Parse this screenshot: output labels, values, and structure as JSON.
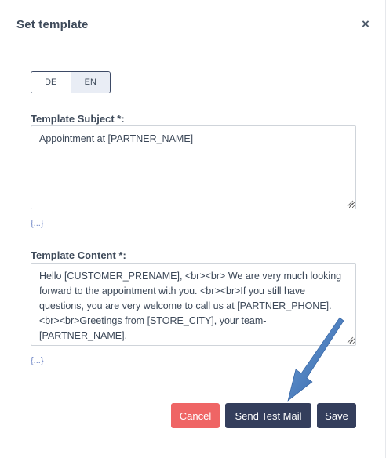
{
  "dialog": {
    "title": "Set template",
    "close_label": "×"
  },
  "languages": [
    {
      "label": "DE",
      "active": false
    },
    {
      "label": "EN",
      "active": true
    }
  ],
  "subject": {
    "label": "Template Subject *:",
    "value": "Appointment at [PARTNER_NAME]",
    "placeholders_link": "{...}"
  },
  "content": {
    "label": "Template Content *:",
    "value": "Hello [CUSTOMER_PRENAME], <br><br> We are very much looking forward to the appointment with you. <br><br>If you still have questions, you are very welcome to call us at [PARTNER_PHONE]. <br><br>Greetings from [STORE_CITY], your team-[PARTNER_NAME].",
    "placeholders_link": "{...}"
  },
  "buttons": {
    "cancel": "Cancel",
    "send_test": "Send Test Mail",
    "save": "Save"
  },
  "colors": {
    "cancel": "#ef6565",
    "primary": "#343e5c",
    "link": "#6d85c6",
    "annotation_arrow": "#3d6fb0"
  },
  "icons": {
    "close": "close-icon",
    "resize": "resize-grip-icon",
    "annotation": "annotation-arrow-icon"
  }
}
